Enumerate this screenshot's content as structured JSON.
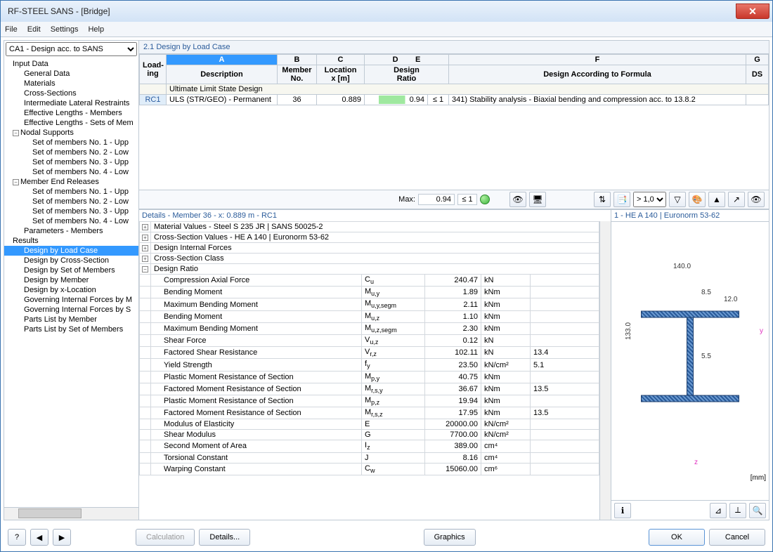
{
  "window": {
    "title": "RF-STEEL SANS - [Bridge]"
  },
  "menu": {
    "file": "File",
    "edit": "Edit",
    "settings": "Settings",
    "help": "Help"
  },
  "left": {
    "selector": "CA1 - Design acc. to SANS",
    "input_data": "Input Data",
    "general_data": "General Data",
    "materials": "Materials",
    "cross_sections": "Cross-Sections",
    "intermediate": "Intermediate Lateral Restraints",
    "eff_members": "Effective Lengths - Members",
    "eff_sets": "Effective Lengths - Sets of Mem",
    "nodal_supports": "Nodal Supports",
    "ns_items": [
      "Set of members No. 1 - Upp",
      "Set of members No. 2 - Low",
      "Set of members No. 3 - Upp",
      "Set of members No. 4 - Low"
    ],
    "member_end": "Member End Releases",
    "me_items": [
      "Set of members No. 1 - Upp",
      "Set of members No. 2 - Low",
      "Set of members No. 3 - Upp",
      "Set of members No. 4 - Low"
    ],
    "parameters": "Parameters - Members",
    "results": "Results",
    "r_items": [
      "Design by Load Case",
      "Design by Cross-Section",
      "Design by Set of Members",
      "Design by Member",
      "Design by x-Location",
      "Governing Internal Forces by M",
      "Governing Internal Forces by S",
      "Parts List by Member",
      "Parts List by Set of Members"
    ]
  },
  "section_title": "2.1 Design by Load Case",
  "grid": {
    "col_letters": [
      "A",
      "B",
      "C",
      "D",
      "E",
      "F",
      "G"
    ],
    "loading": "Load-\ning",
    "description": "Description",
    "member_no": "Member\nNo.",
    "location": "Location\nx [m]",
    "design": "Design\nRatio",
    "formula": "Design According to Formula",
    "ds": "DS",
    "section_row": "Ultimate Limit State Design",
    "row": {
      "loading": "RC1",
      "desc": "ULS (STR/GEO) - Permanent",
      "member": "36",
      "x": "0.889",
      "ratio": "0.94",
      "le1": "≤ 1",
      "formula": "341) Stability analysis - Biaxial bending and compression acc. to 13.8.2"
    }
  },
  "midbar": {
    "max": "Max:",
    "val": "0.94",
    "le1": "≤ 1",
    "filter": "> 1,0"
  },
  "details": {
    "title": "Details - Member 36 - x: 0.889 m - RC1",
    "groups": [
      "Material Values - Steel S 235 JR | SANS 50025-2",
      "Cross-Section Values  -  HE A 140 | Euronorm 53-62",
      "Design Internal Forces",
      "Cross-Section Class"
    ],
    "group_open": "Design Ratio",
    "rows": [
      {
        "name": "Compression Axial Force",
        "sym1": "C",
        "sym2": "u",
        "val": "240.47",
        "unit": "kN",
        "extra": ""
      },
      {
        "name": "Bending Moment",
        "sym1": "M",
        "sym2": "u,y",
        "val": "1.89",
        "unit": "kNm",
        "extra": ""
      },
      {
        "name": "Maximum Bending Moment",
        "sym1": "M",
        "sym2": "u,y,segm",
        "val": "2.11",
        "unit": "kNm",
        "extra": ""
      },
      {
        "name": "Bending Moment",
        "sym1": "M",
        "sym2": "u,z",
        "val": "1.10",
        "unit": "kNm",
        "extra": ""
      },
      {
        "name": "Maximum Bending Moment",
        "sym1": "M",
        "sym2": "u,z,segm",
        "val": "2.30",
        "unit": "kNm",
        "extra": ""
      },
      {
        "name": "Shear Force",
        "sym1": "V",
        "sym2": "u,z",
        "val": "0.12",
        "unit": "kN",
        "extra": ""
      },
      {
        "name": "Factored Shear Resistance",
        "sym1": "V",
        "sym2": "r,z",
        "val": "102.11",
        "unit": "kN",
        "extra": "13.4"
      },
      {
        "name": "Yield Strength",
        "sym1": "f",
        "sym2": "y",
        "val": "23.50",
        "unit": "kN/cm²",
        "extra": "5.1"
      },
      {
        "name": "Plastic Moment Resistance of Section",
        "sym1": "M",
        "sym2": "p,y",
        "val": "40.75",
        "unit": "kNm",
        "extra": ""
      },
      {
        "name": "Factored Moment Resistance of Section",
        "sym1": "M",
        "sym2": "r,s,y",
        "val": "36.67",
        "unit": "kNm",
        "extra": "13.5"
      },
      {
        "name": "Plastic Moment Resistance of Section",
        "sym1": "M",
        "sym2": "p,z",
        "val": "19.94",
        "unit": "kNm",
        "extra": ""
      },
      {
        "name": "Factored Moment Resistance of Section",
        "sym1": "M",
        "sym2": "r,s,z",
        "val": "17.95",
        "unit": "kNm",
        "extra": "13.5"
      },
      {
        "name": "Modulus of Elasticity",
        "sym1": "E",
        "sym2": "",
        "val": "20000.00",
        "unit": "kN/cm²",
        "extra": ""
      },
      {
        "name": "Shear Modulus",
        "sym1": "G",
        "sym2": "",
        "val": "7700.00",
        "unit": "kN/cm²",
        "extra": ""
      },
      {
        "name": "Second Moment of Area",
        "sym1": "I",
        "sym2": "z",
        "val": "389.00",
        "unit": "cm⁴",
        "extra": ""
      },
      {
        "name": "Torsional Constant",
        "sym1": "J",
        "sym2": "",
        "val": "8.16",
        "unit": "cm⁴",
        "extra": ""
      },
      {
        "name": "Warping Constant",
        "sym1": "C",
        "sym2": "w",
        "val": "15060.00",
        "unit": "cm⁶",
        "extra": ""
      }
    ]
  },
  "section": {
    "title": "1 - HE A 140 | Euronorm 53-62",
    "dims": {
      "w": "140.0",
      "h": "133.0",
      "tf": "8.5",
      "tw": "5.5",
      "r": "12.0"
    },
    "axes": {
      "y": "y",
      "z": "z"
    },
    "mm": "[mm]"
  },
  "buttons": {
    "calculation": "Calculation",
    "details": "Details...",
    "graphics": "Graphics",
    "ok": "OK",
    "cancel": "Cancel"
  }
}
